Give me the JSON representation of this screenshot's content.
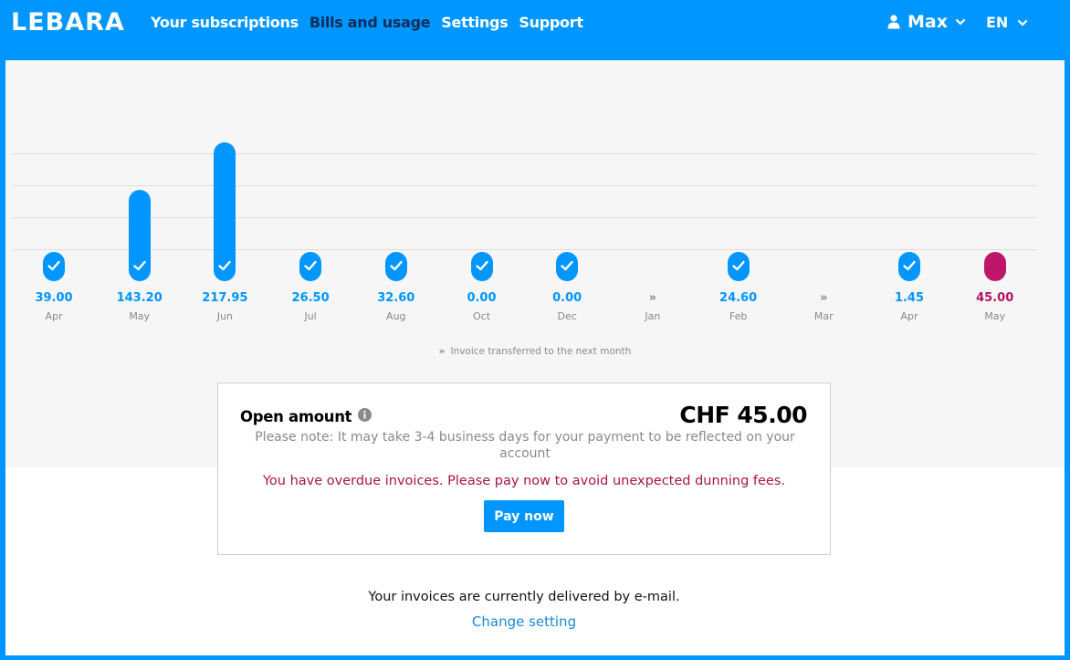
{
  "header": {
    "logo": "LEBARA",
    "nav": [
      "Your subscriptions",
      "Bills and usage",
      "Settings",
      "Support"
    ],
    "active_nav": "Bills and usage",
    "user_name": "Max",
    "language": "EN"
  },
  "chart_data": {
    "type": "bar",
    "categories": [
      "Apr",
      "May",
      "Jun",
      "Jul",
      "Aug",
      "Oct",
      "Dec",
      "Jan",
      "Feb",
      "Mar",
      "Apr",
      "May"
    ],
    "values": [
      39.0,
      143.2,
      217.95,
      26.5,
      32.6,
      0.0,
      0.0,
      null,
      24.6,
      null,
      1.45,
      45.0
    ],
    "value_labels": [
      "39.00",
      "143.20",
      "217.95",
      "26.50",
      "32.60",
      "0.00",
      "0.00",
      "»",
      "24.60",
      "»",
      "1.45",
      "45.00"
    ],
    "status": [
      "paid",
      "paid",
      "paid",
      "paid",
      "paid",
      "paid",
      "paid",
      "transferred",
      "paid",
      "transferred",
      "paid",
      "open"
    ],
    "colors": {
      "paid": "#0096ff",
      "open": "#c0166a",
      "transferred": "#888888"
    },
    "legend": "Invoice transferred to the next month",
    "legend_glyph": "»"
  },
  "open_amount": {
    "title": "Open amount",
    "amount": "CHF 45.00",
    "note": "Please note: It may take 3-4 business days for your payment to be reflected on your account",
    "warning": "You have overdue invoices. Please pay now to avoid unexpected dunning fees.",
    "pay_label": "Pay now"
  },
  "delivery": {
    "text": "Your invoices are currently delivered by e-mail.",
    "link": "Change setting"
  }
}
